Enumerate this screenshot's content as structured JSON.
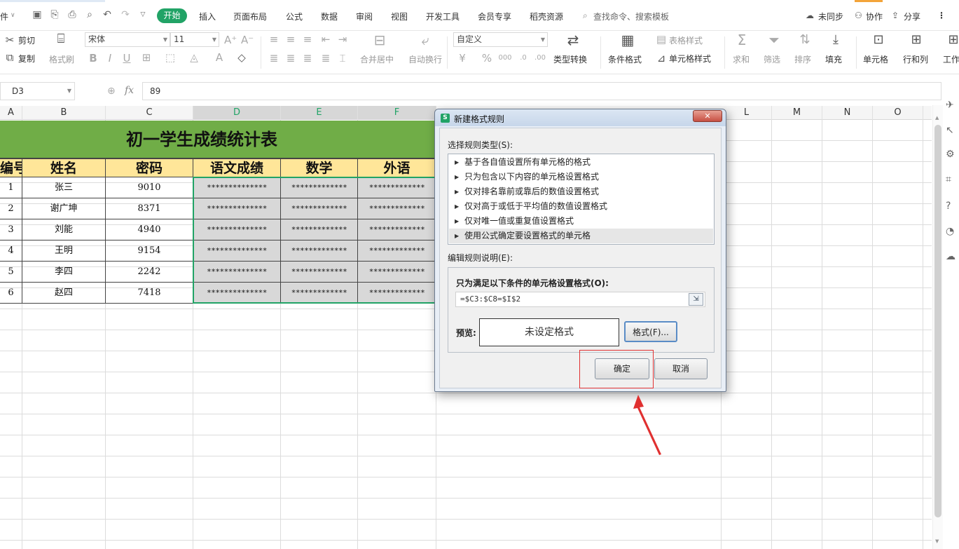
{
  "menubar": {
    "file": "件",
    "tabs": [
      "开始",
      "插入",
      "页面布局",
      "公式",
      "数据",
      "审阅",
      "视图",
      "开发工具",
      "会员专享",
      "稻壳资源"
    ],
    "search": "查找命令、搜索模板",
    "sync": "未同步",
    "collab": "协作",
    "share": "分享"
  },
  "ribbon": {
    "cut": "剪切",
    "copy": "复制",
    "format_painter": "格式刷",
    "font_name": "宋体",
    "font_size": "11",
    "merge_center": "合并居中",
    "wrap": "自动换行",
    "number_format": "自定义",
    "type_convert": "类型转换",
    "cond_format": "条件格式",
    "table_style": "表格样式",
    "cell_style": "单元格样式",
    "sum": "求和",
    "filter": "筛选",
    "sort": "排序",
    "fill": "填充",
    "cell": "单元格",
    "row_col": "行和列",
    "worksheet": "工作"
  },
  "formula_bar": {
    "name_box": "D3",
    "fx": "fx",
    "value": "89"
  },
  "columns": [
    "A",
    "B",
    "C",
    "D",
    "E",
    "F",
    "",
    "",
    "",
    "",
    "L",
    "M",
    "N",
    "O"
  ],
  "sheet": {
    "title": "初一学生成绩统计表",
    "headers": [
      "编号",
      "姓名",
      "密码",
      "语文成绩",
      "数学",
      "外语"
    ],
    "rows": [
      {
        "no": "1",
        "name": "张三",
        "pwd": "9010",
        "c1": "**************",
        "c2": "*************",
        "c3": "*************"
      },
      {
        "no": "2",
        "name": "谢广坤",
        "pwd": "8371",
        "c1": "**************",
        "c2": "*************",
        "c3": "*************"
      },
      {
        "no": "3",
        "name": "刘能",
        "pwd": "4940",
        "c1": "**************",
        "c2": "*************",
        "c3": "*************"
      },
      {
        "no": "4",
        "name": "王明",
        "pwd": "9154",
        "c1": "**************",
        "c2": "*************",
        "c3": "*************"
      },
      {
        "no": "5",
        "name": "李四",
        "pwd": "2242",
        "c1": "**************",
        "c2": "*************",
        "c3": "*************"
      },
      {
        "no": "6",
        "name": "赵四",
        "pwd": "7418",
        "c1": "**************",
        "c2": "*************",
        "c3": "*************"
      }
    ]
  },
  "dialog": {
    "title": "新建格式规则",
    "rule_type_label": "选择规则类型(S):",
    "rule_types": [
      "基于各自值设置所有单元格的格式",
      "只为包含以下内容的单元格设置格式",
      "仅对排名靠前或靠后的数值设置格式",
      "仅对高于或低于平均值的数值设置格式",
      "仅对唯一值或重复值设置格式",
      "使用公式确定要设置格式的单元格"
    ],
    "edit_label": "编辑规则说明(E):",
    "condition_label": "只为满足以下条件的单元格设置格式(O):",
    "formula": "=$C3:$C8=$I$2",
    "preview_label": "预览:",
    "preview_text": "未设定格式",
    "format_button": "格式(F)...",
    "ok": "确定",
    "cancel": "取消"
  },
  "colors": {
    "accent": "#21a366",
    "title_bg": "#70ad47",
    "header_bg": "#ffe699",
    "highlight": "#e03030"
  }
}
